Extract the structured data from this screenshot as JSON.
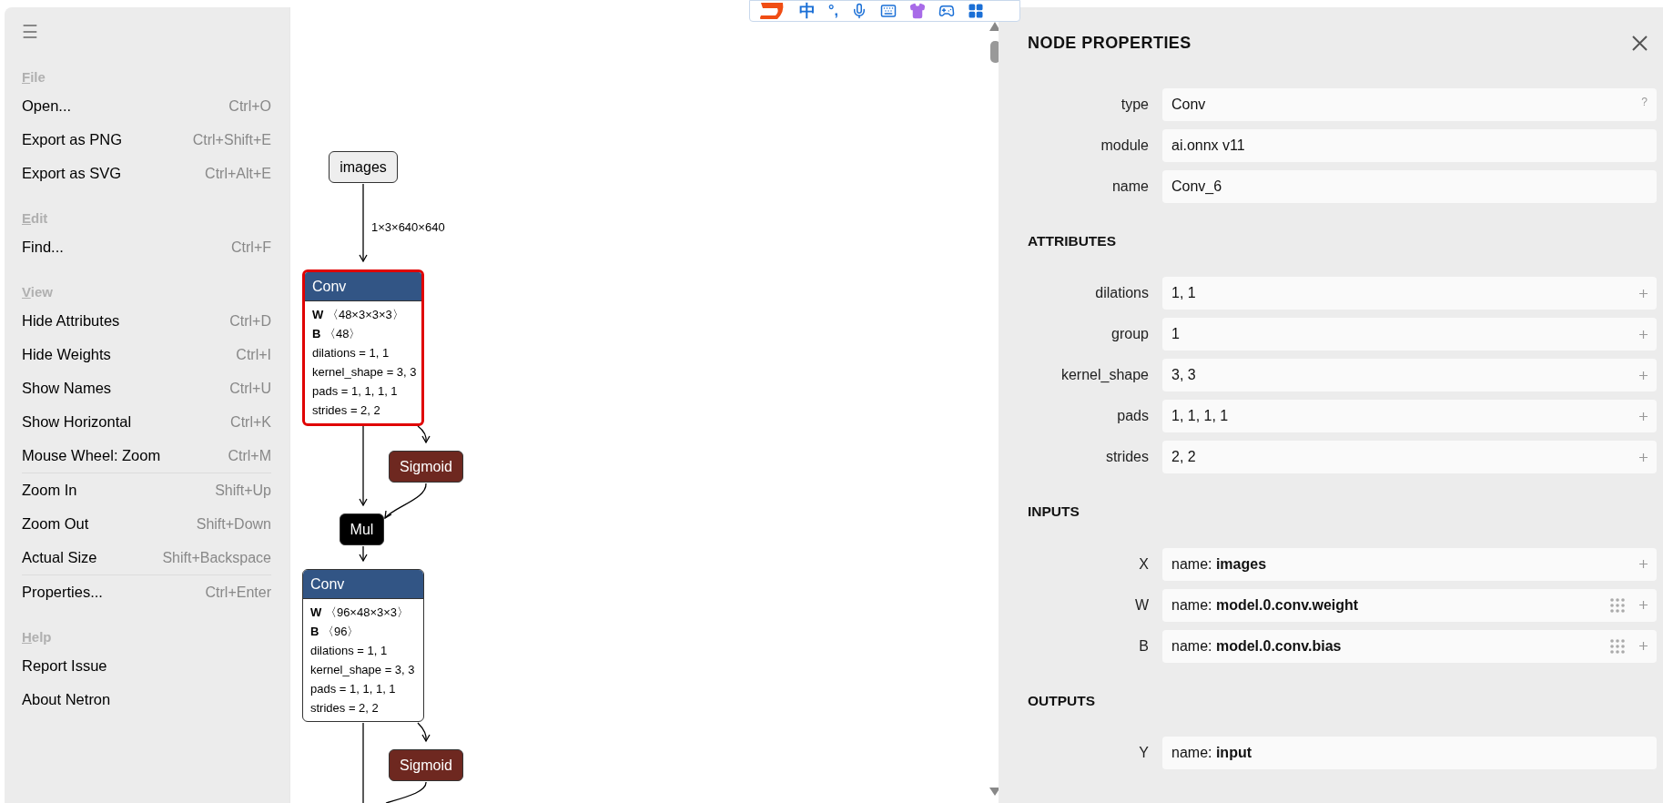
{
  "menu": {
    "toggle": "☰",
    "sections": [
      {
        "title": "File",
        "groups": [
          [
            {
              "label": "Open...",
              "shortcut": "Ctrl+O"
            },
            {
              "label": "Export as PNG",
              "shortcut": "Ctrl+Shift+E"
            },
            {
              "label": "Export as SVG",
              "shortcut": "Ctrl+Alt+E"
            }
          ]
        ]
      },
      {
        "title": "Edit",
        "groups": [
          [
            {
              "label": "Find...",
              "shortcut": "Ctrl+F"
            }
          ]
        ]
      },
      {
        "title": "View",
        "groups": [
          [
            {
              "label": "Hide Attributes",
              "shortcut": "Ctrl+D"
            },
            {
              "label": "Hide Weights",
              "shortcut": "Ctrl+I"
            },
            {
              "label": "Show Names",
              "shortcut": "Ctrl+U"
            },
            {
              "label": "Show Horizontal",
              "shortcut": "Ctrl+K"
            },
            {
              "label": "Mouse Wheel: Zoom",
              "shortcut": "Ctrl+M"
            }
          ],
          [
            {
              "label": "Zoom In",
              "shortcut": "Shift+Up"
            },
            {
              "label": "Zoom Out",
              "shortcut": "Shift+Down"
            },
            {
              "label": "Actual Size",
              "shortcut": "Shift+Backspace"
            }
          ],
          [
            {
              "label": "Properties...",
              "shortcut": "Ctrl+Enter"
            }
          ]
        ]
      },
      {
        "title": "Help",
        "groups": [
          [
            {
              "label": "Report Issue"
            },
            {
              "label": "About Netron"
            }
          ]
        ]
      }
    ]
  },
  "ime_toolbar": {
    "mode": "中",
    "punctuation": "°,"
  },
  "graph": {
    "edge_label": "1×3×640×640",
    "nodes": [
      {
        "kind": "input",
        "title": "images",
        "selected": false
      },
      {
        "kind": "layer",
        "title": "Conv",
        "selected": true,
        "weights": [
          {
            "name": "W",
            "shape": "〈48×3×3×3〉"
          },
          {
            "name": "B",
            "shape": "〈48〉"
          }
        ],
        "attributes": [
          "dilations = 1, 1",
          "kernel_shape = 3, 3",
          "pads = 1, 1, 1, 1",
          "strides = 2, 2"
        ]
      },
      {
        "kind": "activation",
        "title": "Sigmoid",
        "selected": false
      },
      {
        "kind": "op",
        "title": "Mul",
        "selected": false
      },
      {
        "kind": "layer",
        "title": "Conv",
        "selected": false,
        "weights": [
          {
            "name": "W",
            "shape": "〈96×48×3×3〉"
          },
          {
            "name": "B",
            "shape": "〈96〉"
          }
        ],
        "attributes": [
          "dilations = 1, 1",
          "kernel_shape = 3, 3",
          "pads = 1, 1, 1, 1",
          "strides = 2, 2"
        ]
      },
      {
        "kind": "activation",
        "title": "Sigmoid",
        "selected": false
      }
    ]
  },
  "properties": {
    "title": "NODE PROPERTIES",
    "sections": [
      {
        "rows": [
          {
            "label": "type",
            "value": "Conv",
            "help": "?",
            "expandable": false,
            "initializer": false
          },
          {
            "label": "module",
            "value": "ai.onnx v11",
            "expandable": false,
            "initializer": false
          },
          {
            "label": "name",
            "value": "Conv_6",
            "expandable": false,
            "initializer": false
          }
        ]
      },
      {
        "title": "ATTRIBUTES",
        "rows": [
          {
            "label": "dilations",
            "value": "1, 1",
            "expandable": true,
            "initializer": false
          },
          {
            "label": "group",
            "value": "1",
            "expandable": true,
            "initializer": false
          },
          {
            "label": "kernel_shape",
            "value": "3, 3",
            "expandable": true,
            "initializer": false
          },
          {
            "label": "pads",
            "value": "1, 1, 1, 1",
            "expandable": true,
            "initializer": false
          },
          {
            "label": "strides",
            "value": "2, 2",
            "expandable": true,
            "initializer": false
          }
        ]
      },
      {
        "title": "INPUTS",
        "rows": [
          {
            "label": "X",
            "value": "name: **images**",
            "expandable": true,
            "initializer": false
          },
          {
            "label": "W",
            "value": "name: **model.0.conv.weight**",
            "expandable": true,
            "initializer": true
          },
          {
            "label": "B",
            "value": "name: **model.0.conv.bias**",
            "expandable": true,
            "initializer": true
          }
        ]
      },
      {
        "title": "OUTPUTS",
        "rows": [
          {
            "label": "Y",
            "value": "name: **input**",
            "expandable": false,
            "initializer": false
          }
        ]
      }
    ]
  }
}
